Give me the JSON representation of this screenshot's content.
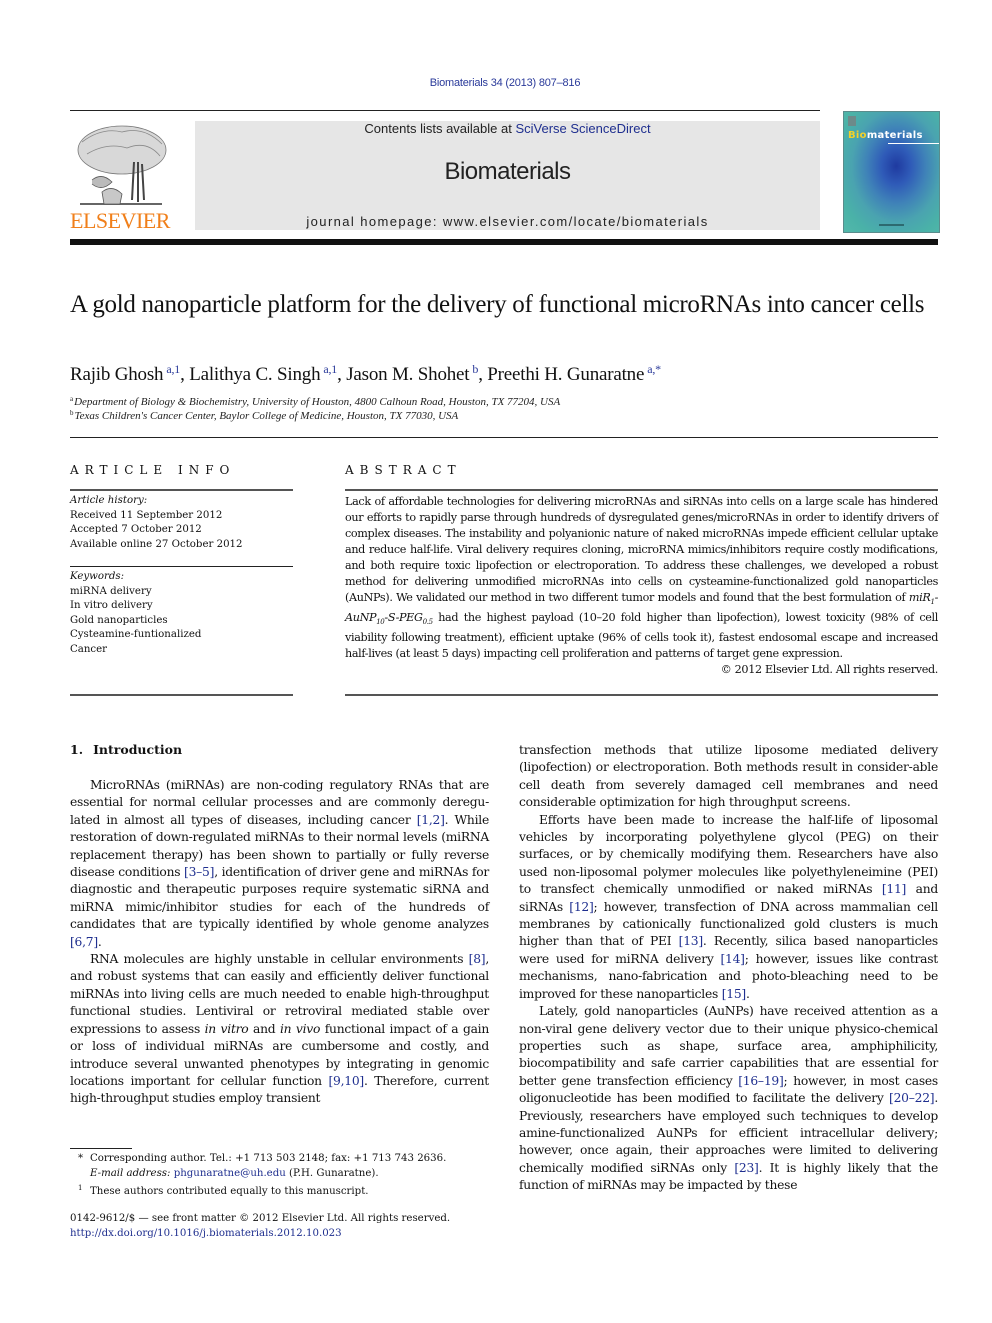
{
  "header": {
    "citation": "Biomaterials 34 (2013) 807–816",
    "contents_prefix": "Contents lists available at ",
    "contents_link": "SciVerse ScienceDirect",
    "journal_name": "Biomaterials",
    "homepage": "journal homepage: www.elsevier.com/locate/biomaterials",
    "publisher_logo_text": "ELSEVIER",
    "publisher_logo_color": "#f07f1a",
    "cover": {
      "title_accent": "Bio",
      "title_rest": "materials",
      "accent_color": "#f3d12a"
    }
  },
  "article": {
    "title": "A gold nanoparticle platform for the delivery of functional microRNAs into cancer cells",
    "authors": [
      {
        "name": "Rajib Ghosh",
        "sup": "a,1"
      },
      {
        "name": "Lalithya C. Singh",
        "sup": "a,1"
      },
      {
        "name": "Jason M. Shohet",
        "sup": "b"
      },
      {
        "name": "Preethi H. Gunaratne",
        "sup": "a,*"
      }
    ],
    "affiliations": [
      {
        "mark": "a",
        "text": "Department of Biology & Biochemistry, University of Houston, 4800 Calhoun Road, Houston, TX 77204, USA"
      },
      {
        "mark": "b",
        "text": "Texas Children's Cancer Center, Baylor College of Medicine, Houston, TX 77030, USA"
      }
    ]
  },
  "article_info": {
    "heading": "ARTICLE INFO",
    "history_label": "Article history:",
    "history": [
      "Received 11 September 2012",
      "Accepted 7 October 2012",
      "Available online 27 October 2012"
    ],
    "keywords_label": "Keywords:",
    "keywords": [
      "miRNA delivery",
      "In vitro delivery",
      "Gold nanoparticles",
      "Cysteamine-funtionalized",
      "Cancer"
    ]
  },
  "abstract": {
    "heading": "ABSTRACT",
    "text_before_formula": "Lack of affordable technologies for delivering microRNAs and siRNAs into cells on a large scale has hindered our efforts to rapidly parse through hundreds of dysregulated genes/microRNAs in order to identify drivers of complex diseases. The instability and polyanionic nature of naked microRNAs impede efficient cellular uptake and reduce half-life. Viral delivery requires cloning, microRNA mimics/inhibitors require costly modifications, and both require toxic lipofection or electroporation. To address these challenges, we developed a robust method for delivering unmodified microRNAs into cells on cysteamine-functionalized gold nanoparticles (AuNPs). We validated our method in two different tumor models and found that the best formulation of ",
    "formula": {
      "p1": "miR",
      "s1": "1",
      "p2": "-AuNP",
      "s2": "10",
      "p3": "-S-PEG",
      "s3": "0.5"
    },
    "text_after_formula": " had the highest payload (10–20 fold higher than lipofection), lowest toxicity (98% of cell viability following treatment), efficient uptake (96% of cells took it), fastest endosomal escape and increased half-lives (at least 5 days) impacting cell proliferation and patterns of target gene expression.",
    "copyright": "© 2012 Elsevier Ltd. All rights reserved."
  },
  "introduction": {
    "number": "1.",
    "heading": "Introduction",
    "left_paragraphs": [
      [
        {
          "t": "MicroRNAs (miRNAs) are non-coding regulatory RNAs that are essential for normal cellular processes and are commonly deregu-lated in almost all types of diseases, including cancer "
        },
        {
          "ref": "[1,2]"
        },
        {
          "t": ". While restoration of down-regulated miRNAs to their normal levels (miRNA replacement therapy) has been shown to partially or fully reverse disease conditions "
        },
        {
          "ref": "[3–5]"
        },
        {
          "t": ", identification of driver gene and miRNAs for diagnostic and therapeutic purposes require systematic siRNA and miRNA mimic/inhibitor studies for each of the hundreds of candidates that are typically identified by whole genome analyzes "
        },
        {
          "ref": "[6,7]"
        },
        {
          "t": "."
        }
      ],
      [
        {
          "t": "RNA molecules are highly unstable in cellular environments "
        },
        {
          "ref": "[8]"
        },
        {
          "t": ", and robust systems that can easily and efficiently deliver functional miRNAs into living cells are much needed to enable high-throughput functional studies. Lentiviral or retroviral mediated stable over expressions to assess "
        },
        {
          "i": "in vitro"
        },
        {
          "t": " and "
        },
        {
          "i": "in vivo"
        },
        {
          "t": " functional impact of a gain or loss of individual miRNAs are cumbersome and costly, and introduce several unwanted phenotypes by integrating in genomic locations important for cellular function "
        },
        {
          "ref": "[9,10]"
        },
        {
          "t": ". Therefore, current high-throughput studies employ transient"
        }
      ]
    ],
    "right_paragraphs": [
      [
        {
          "t": "transfection methods that utilize liposome mediated delivery (lipofection) or electroporation. Both methods result in consider-able cell death from severely damaged cell membranes and need considerable optimization for high throughput screens."
        }
      ],
      [
        {
          "t": "Efforts have been made to increase the half-life of liposomal vehicles by incorporating polyethylene glycol (PEG) on their surfaces, or by chemically modifying them. Researchers have also used non-liposomal polymer molecules like polyethyleneimine (PEI) to transfect chemically unmodified or naked miRNAs "
        },
        {
          "ref": "[11]"
        },
        {
          "t": " and siRNAs "
        },
        {
          "ref": "[12]"
        },
        {
          "t": "; however, transfection of DNA across mammalian cell membranes by cationically functionalized gold clusters is much higher than that of PEI "
        },
        {
          "ref": "[13]"
        },
        {
          "t": ". Recently, silica based nanoparticles were used for miRNA delivery "
        },
        {
          "ref": "[14]"
        },
        {
          "t": "; however, issues like contrast mechanisms, nano-fabrication and photo-bleaching need to be improved for these nanoparticles "
        },
        {
          "ref": "[15]"
        },
        {
          "t": "."
        }
      ],
      [
        {
          "t": "Lately, gold nanoparticles (AuNPs) have received attention as a non-viral gene delivery vector due to their unique physico-chemical properties such as shape, surface area, amphiphilicity, biocompatibility and safe carrier capabilities that are essential for better gene transfection efficiency "
        },
        {
          "ref": "[16–19]"
        },
        {
          "t": "; however, in most cases oligonucleotide has been modified to facilitate the delivery "
        },
        {
          "ref": "[20–22]"
        },
        {
          "t": ". Previously, researchers have employed such techniques to develop amine-functionalized AuNPs for efficient intracellular delivery; however, once again, their approaches were limited to delivering chemically modified siRNAs only "
        },
        {
          "ref": "[23]"
        },
        {
          "t": ". It is highly likely that the function of miRNAs may be impacted by these"
        }
      ]
    ]
  },
  "footnotes": {
    "corresponding": {
      "mark": "*",
      "text": "Corresponding author. Tel.: +1 713 503 2148; fax: +1 713 743 2636.",
      "email_label": "E-mail address: ",
      "email": "phgunaratne@uh.edu",
      "email_suffix": " (P.H. Gunaratne)."
    },
    "equal": {
      "mark": "1",
      "text": "These authors contributed equally to this manuscript."
    },
    "frontmatter": "0142-9612/$ — see front matter © 2012 Elsevier Ltd. All rights reserved.",
    "doi": "http://dx.doi.org/10.1016/j.biomaterials.2012.10.023"
  },
  "colors": {
    "link": "#1f2f8f",
    "banner_bg": "#e6e6e6"
  }
}
